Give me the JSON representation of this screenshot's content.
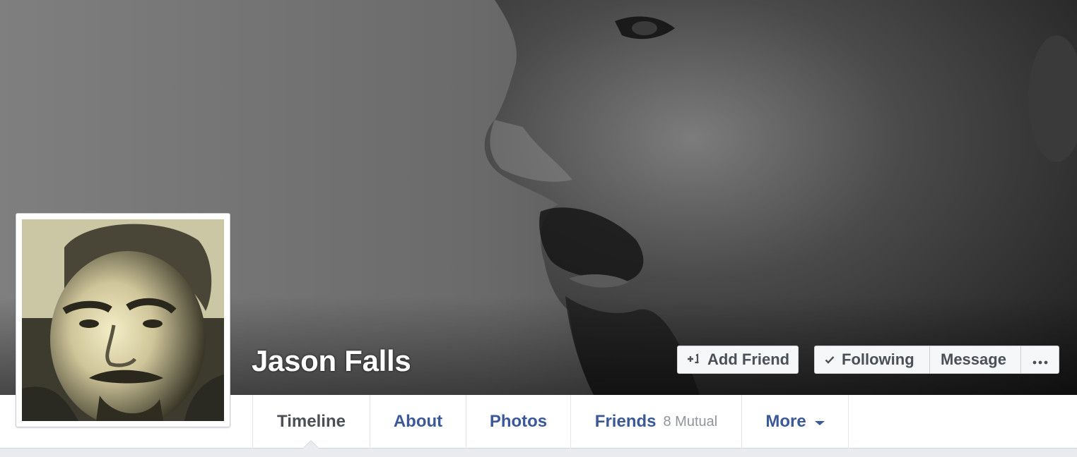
{
  "profile": {
    "name": "Jason Falls"
  },
  "actions": {
    "add_friend": "Add Friend",
    "following": "Following",
    "message": "Message",
    "more": "•••"
  },
  "tabs": [
    {
      "label": "Timeline",
      "active": true
    },
    {
      "label": "About"
    },
    {
      "label": "Photos"
    },
    {
      "label": "Friends",
      "sub": "8 Mutual"
    },
    {
      "label": "More"
    }
  ],
  "colors": {
    "link": "#3b5998",
    "text": "#4b4f56",
    "muted": "#90949c",
    "button_bg": "#f6f7f9",
    "border": "#ced0d4"
  },
  "icons": {
    "add_friend": "add-friend-icon",
    "following": "checkmark-icon",
    "more": "ellipsis-icon",
    "tab_more": "chevron-down-icon"
  }
}
